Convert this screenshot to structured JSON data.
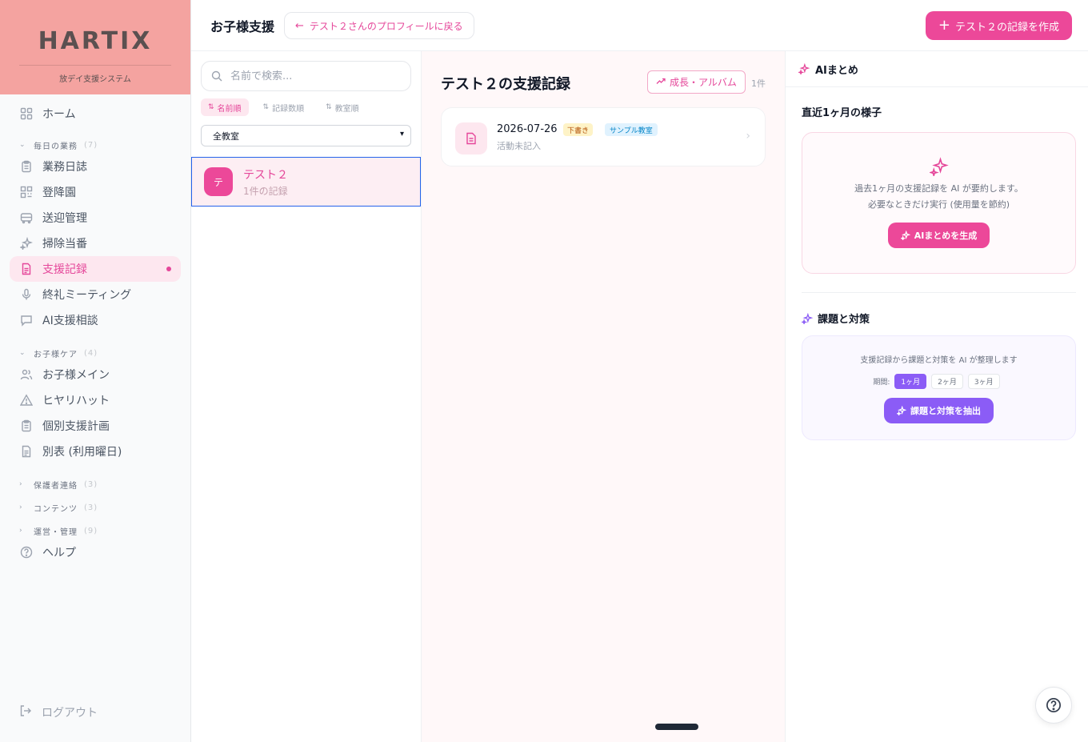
{
  "brand": {
    "logo": "HARTIX",
    "subtitle": "放デイ支援システム"
  },
  "sidebar": {
    "home": "ホーム",
    "groups": [
      {
        "label": "毎日の業務",
        "count": "(7)"
      },
      {
        "label": "お子様ケア",
        "count": "(4)"
      },
      {
        "label": "保護者連絡",
        "count": "(3)"
      },
      {
        "label": "コンテンツ",
        "count": "(3)"
      },
      {
        "label": "運営・管理",
        "count": "(9)"
      }
    ],
    "daily": [
      "業務日誌",
      "登降園",
      "送迎管理",
      "掃除当番",
      "支援記録",
      "終礼ミーティング",
      "AI支援相談"
    ],
    "care": [
      "お子様メイン",
      "ヒヤリハット",
      "個別支援計画",
      "別表 (利用曜日)"
    ],
    "help": "ヘルプ",
    "logout": "ログアウト"
  },
  "header": {
    "title": "お子様支援",
    "back": "テスト２さんのプロフィールに戻る",
    "create": "テスト２の記録を作成"
  },
  "list": {
    "search_placeholder": "名前で検索...",
    "sorts": [
      "名前順",
      "記録数順",
      "教室順"
    ],
    "room_filter": "全教室",
    "student": {
      "initial": "テ",
      "name": "テスト２",
      "sub": "1件の記録"
    }
  },
  "main": {
    "title": "テスト２の支援記録",
    "album": "成長・アルバム",
    "count": "1件",
    "record": {
      "date": "2026-07-26",
      "status": "下書き",
      "room": "サンプル教室",
      "sub": "活動未記入"
    }
  },
  "ai": {
    "header": "AIまとめ",
    "section_title": "直近1ヶ月の様子",
    "desc_line1": "過去1ヶ月の支援記録を AI が要約します。",
    "desc_line2": "必要なときだけ実行 (使用量を節約)",
    "generate": "AIまとめを生成",
    "issues_title": "課題と対策",
    "issues_desc": "支援記録から課題と対策を AI が整理します",
    "period_label": "期間:",
    "periods": [
      "1ヶ月",
      "2ヶ月",
      "3ヶ月"
    ],
    "extract": "課題と対策を抽出"
  },
  "colors": {
    "accent": "#ec4899",
    "purple": "#8b5cf6",
    "brand_bg": "#f4a3a0"
  }
}
